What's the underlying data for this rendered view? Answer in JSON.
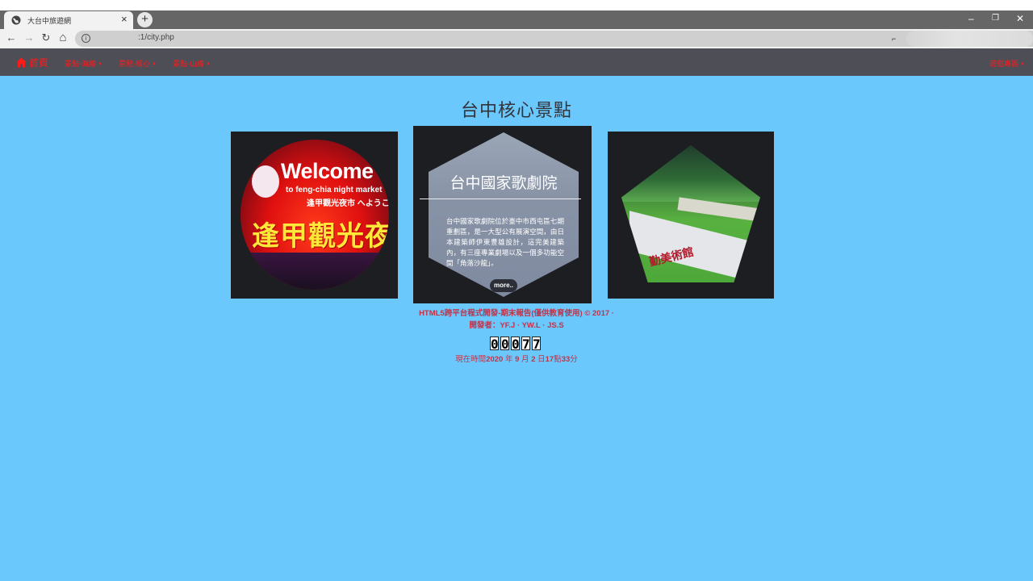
{
  "browser": {
    "tab_title": "大台中旅遊網",
    "new_tab_label": "+",
    "close_label": "×",
    "url": ":1/city.php",
    "info_glyph": "i",
    "window_controls": [
      "–",
      "❐",
      "✕"
    ],
    "nav_glyphs": {
      "back": "←",
      "forward": "→",
      "reload": "↻",
      "home": "⌂"
    }
  },
  "sitenav": {
    "home_label": "首頁",
    "items": [
      {
        "label": "景點-海線"
      },
      {
        "label": "景點-核心"
      },
      {
        "label": "景點-山線"
      }
    ],
    "right_item": {
      "label": "遊戲專區"
    },
    "link_color": "#ff1a1a"
  },
  "page": {
    "title": "台中核心景點",
    "background_color": "#6ac8fc"
  },
  "cards": {
    "left": {
      "sign_welcome": "Welcome",
      "sign_sub": "to feng-chia night market",
      "sign_sub2": "逢甲觀光夜市 へようこそ",
      "sign_cn": "逢甲觀光夜市"
    },
    "middle": {
      "title": "台中國家歌劇院",
      "description": "台中國家歌劇院位於臺中市西屯區七期重劃區，是一大型公有展演空間，由日本建築師伊東豊雄設計，這完美建築內，有三座專業劇場以及一個多功能空間「角落沙龍」。",
      "more_label": "more.."
    },
    "right": {
      "sign_text": "勤美術館"
    }
  },
  "footer": {
    "line1": "HTML5跨平台程式開發-期末報告(僅供教育使用) © 2017 ·",
    "line2": "開發者：YF.J · YW.L · JS.S",
    "counter_digits": [
      "0",
      "0",
      "0",
      "7",
      "7"
    ],
    "time_prefix": "現在時間",
    "year": "2020",
    "year_unit": " 年 ",
    "month": "9",
    "month_unit": " 月 ",
    "day": "2",
    "day_unit": " 日",
    "hour": "17",
    "hour_unit": "點",
    "minute": "33",
    "minute_unit": "分",
    "text_color": "#c0344a"
  }
}
